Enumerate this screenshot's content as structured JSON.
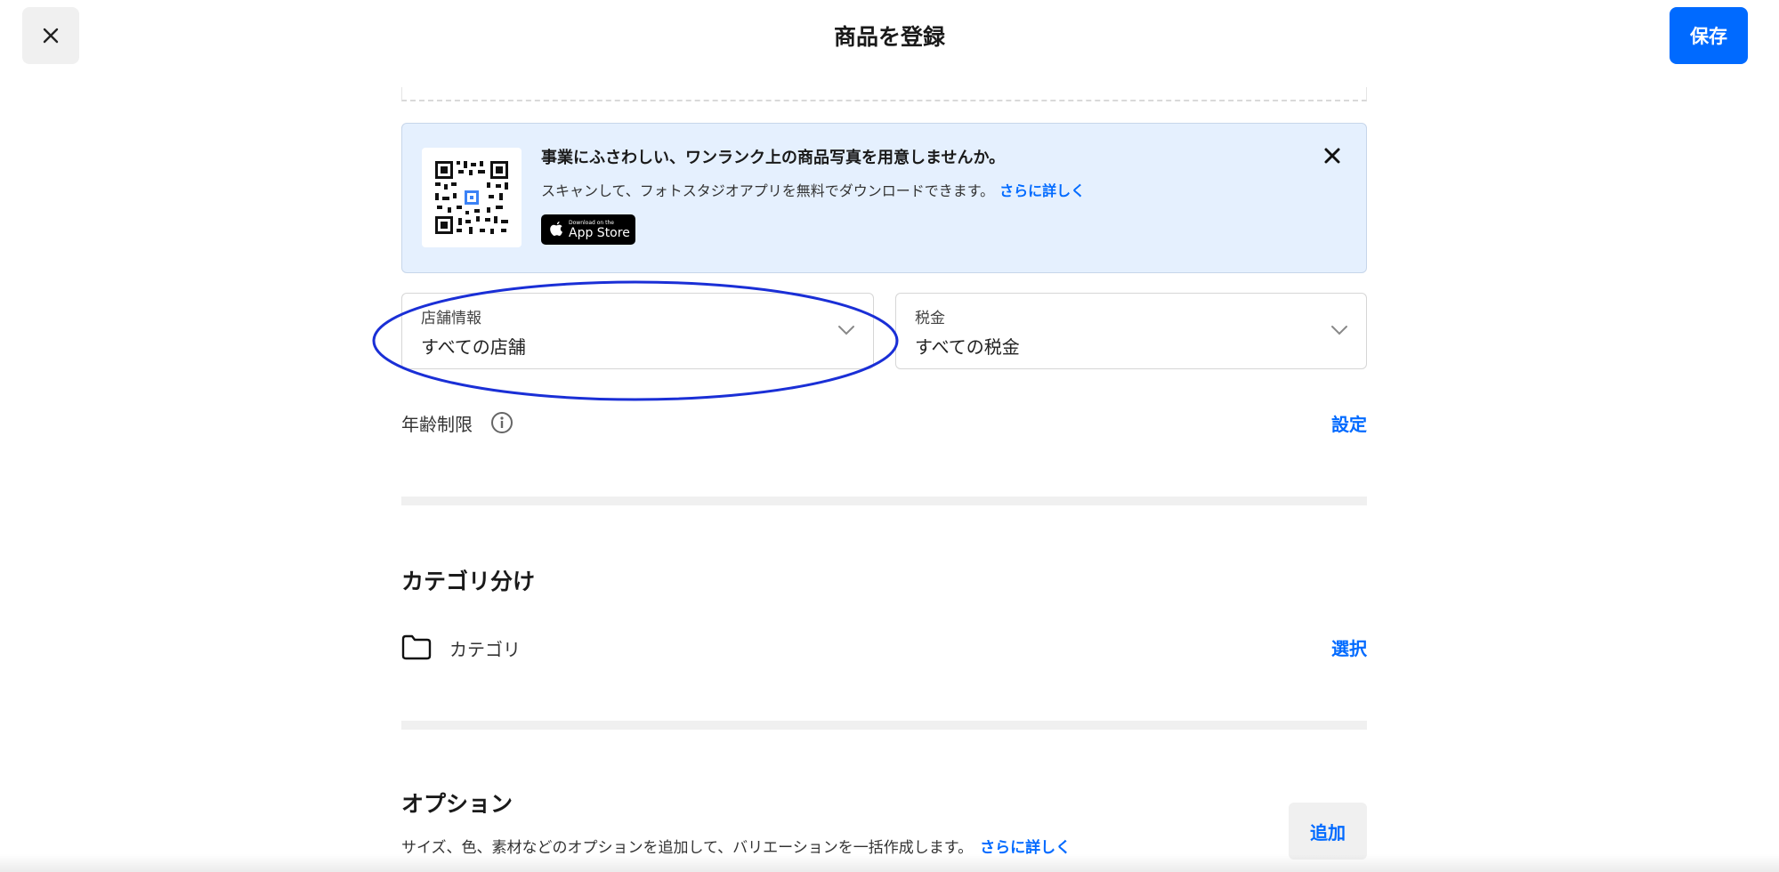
{
  "header": {
    "title": "商品を登録",
    "save_label": "保存"
  },
  "banner": {
    "title": "事業にふさわしい、ワンランク上の商品写真を用意しませんか。",
    "description": "スキャンして、フォトスタジオアプリを無料でダウンロードできます。",
    "link": "さらに詳しく",
    "appstore_small": "Download on the",
    "appstore_big": "App Store"
  },
  "store_select": {
    "label": "店舗情報",
    "value": "すべての店舗"
  },
  "tax_select": {
    "label": "税金",
    "value": "すべての税金"
  },
  "age_restriction": {
    "label": "年齢制限",
    "action": "設定"
  },
  "category_section": {
    "title": "カテゴリ分け",
    "item_label": "カテゴリ",
    "action": "選択"
  },
  "options_section": {
    "title": "オプション",
    "description": "サイズ、色、素材などのオプションを追加して、バリエーションを一括作成します。",
    "link": "さらに詳しく",
    "add_label": "追加"
  },
  "colors": {
    "accent": "#006aff",
    "highlight_ellipse": "#1a2fd6",
    "banner_bg": "#e5f0fe"
  }
}
